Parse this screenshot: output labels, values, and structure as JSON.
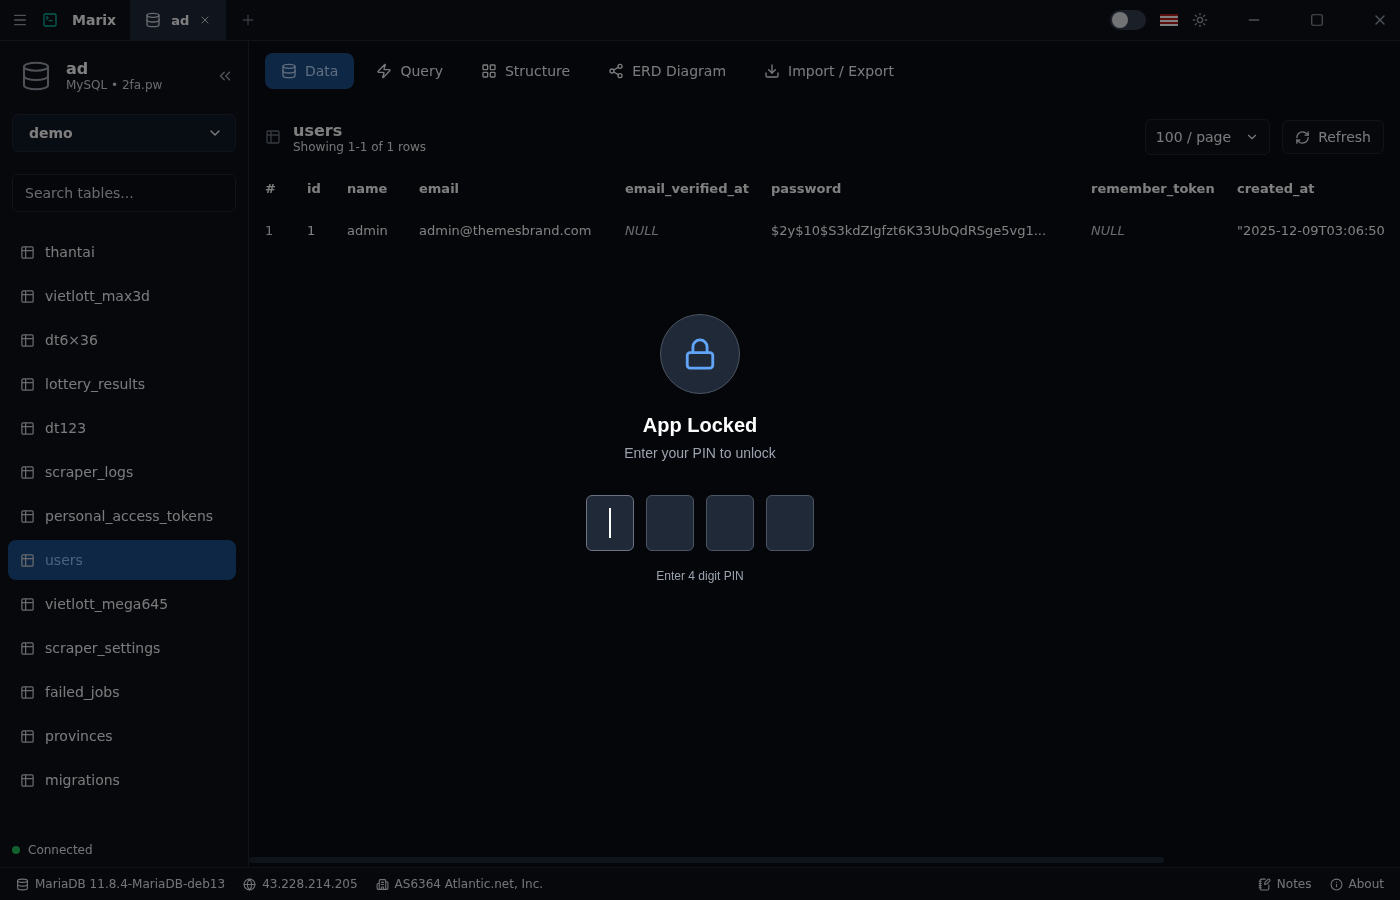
{
  "titlebar": {
    "app_name": "Marix",
    "tabs": [
      {
        "label": "ad",
        "selected": true
      }
    ]
  },
  "theme_toggle": {
    "on": false
  },
  "connection": {
    "name": "ad",
    "subtitle": "MySQL • 2fa.pw"
  },
  "database_select": {
    "value": "demo"
  },
  "table_search": {
    "placeholder": "Search tables..."
  },
  "sidebar": {
    "items": [
      {
        "label": "thantai",
        "selected": false
      },
      {
        "label": "vietlott_max3d",
        "selected": false
      },
      {
        "label": "dt6×36",
        "selected": false
      },
      {
        "label": "lottery_results",
        "selected": false
      },
      {
        "label": "dt123",
        "selected": false
      },
      {
        "label": "scraper_logs",
        "selected": false
      },
      {
        "label": "personal_access_tokens",
        "selected": false
      },
      {
        "label": "users",
        "selected": true
      },
      {
        "label": "vietlott_mega645",
        "selected": false
      },
      {
        "label": "scraper_settings",
        "selected": false
      },
      {
        "label": "failed_jobs",
        "selected": false
      },
      {
        "label": "provinces",
        "selected": false
      },
      {
        "label": "migrations",
        "selected": false
      }
    ]
  },
  "connection_status": {
    "label": "Connected",
    "color": "#11622f"
  },
  "view_tabs": [
    {
      "label": "Data",
      "kind": "data",
      "selected": true
    },
    {
      "label": "Query",
      "kind": "query",
      "selected": false
    },
    {
      "label": "Structure",
      "kind": "structure",
      "selected": false
    },
    {
      "label": "ERD Diagram",
      "kind": "erd",
      "selected": false
    },
    {
      "label": "Import / Export",
      "kind": "import",
      "selected": false
    }
  ],
  "table_header": {
    "title": "users",
    "subtitle": "Showing 1-1 of 1 rows",
    "page_size": "100 / page",
    "refresh": "Refresh"
  },
  "table": {
    "columns": [
      "#",
      "id",
      "name",
      "email",
      "email_verified_at",
      "password",
      "remember_token",
      "created_at"
    ],
    "rows": [
      [
        {
          "text": "1",
          "kind": "index"
        },
        {
          "text": "1",
          "kind": "value"
        },
        {
          "text": "admin",
          "kind": "value"
        },
        {
          "text": "admin@themesbrand.com",
          "kind": "value"
        },
        {
          "text": "NULL",
          "kind": "null"
        },
        {
          "text": "$2y$10$S3kdZIgfzt6K33UbQdRSge5vg1...",
          "kind": "value"
        },
        {
          "text": "NULL",
          "kind": "null"
        },
        {
          "text": "\"2025-12-09T03:06:50",
          "kind": "value"
        }
      ]
    ]
  },
  "status_bar": {
    "items": [
      {
        "text": "MariaDB 11.8.4-MariaDB-deb13",
        "kind": "database"
      },
      {
        "text": "43.228.214.205",
        "kind": "ip"
      },
      {
        "text": "AS6364 Atlantic.net, Inc.",
        "kind": "org"
      }
    ],
    "links": [
      {
        "text": "Notes",
        "kind": "notes"
      },
      {
        "text": "About",
        "kind": "about"
      }
    ]
  },
  "lock": {
    "title": "App Locked",
    "subtitle": "Enter your PIN to unlock",
    "pin_boxes": [
      {
        "focused": true
      },
      {
        "focused": false
      },
      {
        "focused": false
      },
      {
        "focused": false
      }
    ],
    "hint": "Enter 4 digit PIN"
  }
}
